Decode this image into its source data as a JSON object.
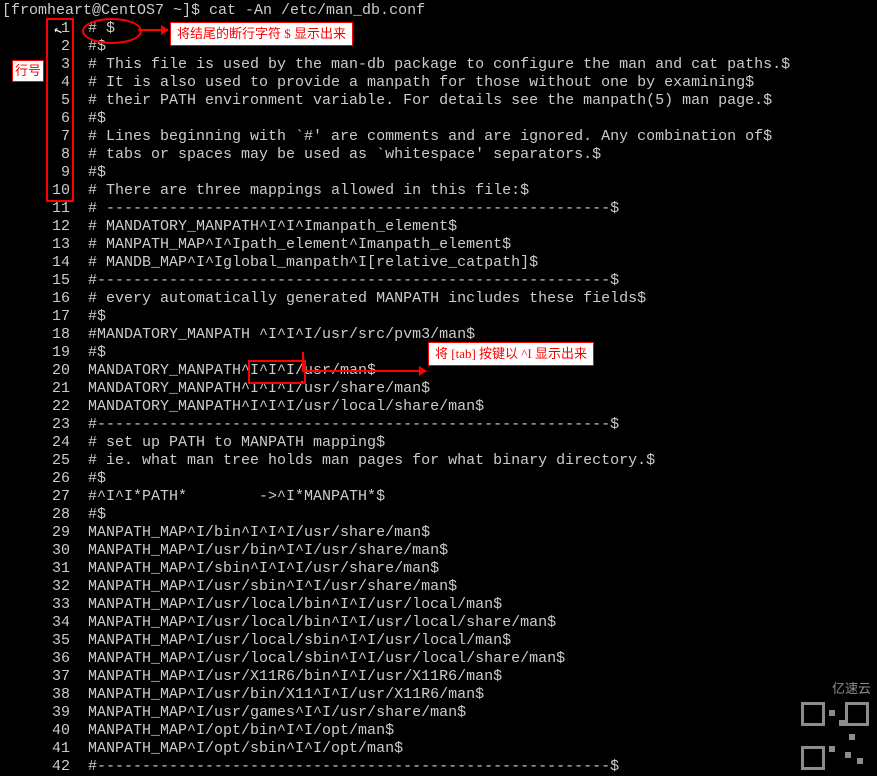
{
  "prompt": "[fromheart@CentOS7 ~]$ cat -An /etc/man_db.conf",
  "annotations": {
    "linehao": "行号",
    "note1": "将结尾的断行字符 $ 显示出来",
    "note2": "将 [tab] 按键以 ^I 显示出来",
    "watermark": "亿速云"
  },
  "lines": [
    {
      "n": 1,
      "t": "# $"
    },
    {
      "n": 2,
      "t": "#$"
    },
    {
      "n": 3,
      "t": "# This file is used by the man-db package to configure the man and cat paths.$"
    },
    {
      "n": 4,
      "t": "# It is also used to provide a manpath for those without one by examining$"
    },
    {
      "n": 5,
      "t": "# their PATH environment variable. For details see the manpath(5) man page.$"
    },
    {
      "n": 6,
      "t": "#$"
    },
    {
      "n": 7,
      "t": "# Lines beginning with `#' are comments and are ignored. Any combination of$"
    },
    {
      "n": 8,
      "t": "# tabs or spaces may be used as `whitespace' separators.$"
    },
    {
      "n": 9,
      "t": "#$"
    },
    {
      "n": 10,
      "t": "# There are three mappings allowed in this file:$"
    },
    {
      "n": 11,
      "t": "# --------------------------------------------------------$"
    },
    {
      "n": 12,
      "t": "# MANDATORY_MANPATH^I^I^Imanpath_element$"
    },
    {
      "n": 13,
      "t": "# MANPATH_MAP^I^Ipath_element^Imanpath_element$"
    },
    {
      "n": 14,
      "t": "# MANDB_MAP^I^Iglobal_manpath^I[relative_catpath]$"
    },
    {
      "n": 15,
      "t": "#---------------------------------------------------------$"
    },
    {
      "n": 16,
      "t": "# every automatically generated MANPATH includes these fields$"
    },
    {
      "n": 17,
      "t": "#$"
    },
    {
      "n": 18,
      "t": "#MANDATORY_MANPATH ^I^I^I/usr/src/pvm3/man$"
    },
    {
      "n": 19,
      "t": "#$"
    },
    {
      "n": 20,
      "t": "MANDATORY_MANPATH^I^I^I/usr/man$"
    },
    {
      "n": 21,
      "t": "MANDATORY_MANPATH^I^I^I/usr/share/man$"
    },
    {
      "n": 22,
      "t": "MANDATORY_MANPATH^I^I^I/usr/local/share/man$"
    },
    {
      "n": 23,
      "t": "#---------------------------------------------------------$"
    },
    {
      "n": 24,
      "t": "# set up PATH to MANPATH mapping$"
    },
    {
      "n": 25,
      "t": "# ie. what man tree holds man pages for what binary directory.$"
    },
    {
      "n": 26,
      "t": "#$"
    },
    {
      "n": 27,
      "t": "#^I^I*PATH*        ->^I*MANPATH*$"
    },
    {
      "n": 28,
      "t": "#$"
    },
    {
      "n": 29,
      "t": "MANPATH_MAP^I/bin^I^I^I/usr/share/man$"
    },
    {
      "n": 30,
      "t": "MANPATH_MAP^I/usr/bin^I^I/usr/share/man$"
    },
    {
      "n": 31,
      "t": "MANPATH_MAP^I/sbin^I^I^I/usr/share/man$"
    },
    {
      "n": 32,
      "t": "MANPATH_MAP^I/usr/sbin^I^I/usr/share/man$"
    },
    {
      "n": 33,
      "t": "MANPATH_MAP^I/usr/local/bin^I^I/usr/local/man$"
    },
    {
      "n": 34,
      "t": "MANPATH_MAP^I/usr/local/bin^I^I/usr/local/share/man$"
    },
    {
      "n": 35,
      "t": "MANPATH_MAP^I/usr/local/sbin^I^I/usr/local/man$"
    },
    {
      "n": 36,
      "t": "MANPATH_MAP^I/usr/local/sbin^I^I/usr/local/share/man$"
    },
    {
      "n": 37,
      "t": "MANPATH_MAP^I/usr/X11R6/bin^I^I/usr/X11R6/man$"
    },
    {
      "n": 38,
      "t": "MANPATH_MAP^I/usr/bin/X11^I^I/usr/X11R6/man$"
    },
    {
      "n": 39,
      "t": "MANPATH_MAP^I/usr/games^I^I/usr/share/man$"
    },
    {
      "n": 40,
      "t": "MANPATH_MAP^I/opt/bin^I^I/opt/man$"
    },
    {
      "n": 41,
      "t": "MANPATH_MAP^I/opt/sbin^I^I/opt/man$"
    },
    {
      "n": 42,
      "t": "#---------------------------------------------------------$"
    }
  ]
}
